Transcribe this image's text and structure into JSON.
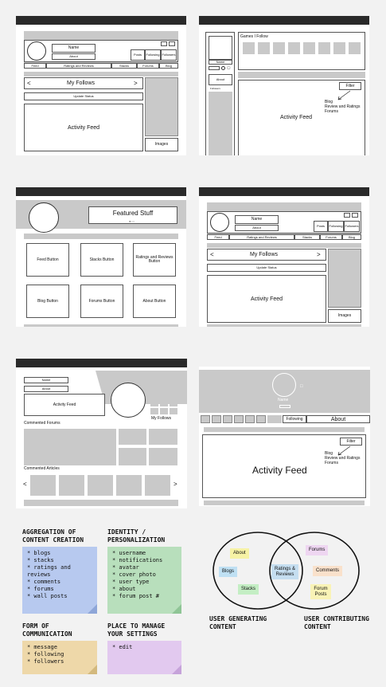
{
  "wf1": {
    "name": "Name",
    "about": "About",
    "profile_buttons": [
      "Posts",
      "Following",
      "Followers"
    ],
    "tabs": [
      "Feed",
      "Ratings and Reviews",
      "Stacks",
      "Forums",
      "Blog"
    ],
    "follows_title": "My Follows",
    "update_status": "Update Status",
    "activity_feed": "Activity Feed",
    "images": "Images"
  },
  "wf2": {
    "games_title": "Games I Follow",
    "name": "Name",
    "about": "About",
    "small_label": "Followers",
    "filter": "Filter",
    "filter_options": [
      "Blog",
      "Review and Ratings",
      "Forums"
    ],
    "activity_feed": "Activity Feed"
  },
  "wf3": {
    "featured": "Featured Stuff",
    "buttons": [
      "Feed Button",
      "Stacks Button",
      "Ratings and Reviews Button",
      "Blog Button",
      "Forums Button",
      "About Button"
    ]
  },
  "wf4": {
    "name": "Name",
    "about": "About",
    "profile_buttons": [
      "Posts",
      "Following",
      "Followers"
    ],
    "tabs": [
      "Feed",
      "Ratings and Reviews",
      "Stacks",
      "Forums",
      "Blog"
    ],
    "follows_title": "My Follows",
    "update_status": "Update Status",
    "activity_feed": "Activity Feed",
    "images": "Images"
  },
  "wf5": {
    "name": "Name",
    "about": "About",
    "activity_feed": "Activity Feed",
    "my_follows": "My Follows",
    "commented_forums": "Commented Forums",
    "commented_articles": "Commented Articles"
  },
  "wf6": {
    "name": "Name",
    "following": "Following",
    "about": "About",
    "filter": "Filter",
    "filter_options": [
      "Blog",
      "Review and Ratings",
      "Forums"
    ],
    "activity_feed": "Activity Feed"
  },
  "notes": [
    {
      "heading": "AGGREGATION OF\nCONTENT CREATION",
      "items": [
        "blogs",
        "stacks",
        "ratings and reviews",
        "comments",
        "forums",
        "wall posts"
      ],
      "color": "#b7c9ef"
    },
    {
      "heading": "IDENTITY /\nPERSONALIZATION",
      "items": [
        "username",
        "notifications",
        "avatar",
        "cover photo",
        "user type",
        "about",
        "forum post #"
      ],
      "color": "#b8dfbc"
    },
    {
      "heading": "FORM OF\nCOMMUNICATION",
      "items": [
        "message",
        "following",
        "followers"
      ],
      "color": "#eed8a9"
    },
    {
      "heading": "PLACE TO MANAGE\nYOUR SETTINGS",
      "items": [
        "edit"
      ],
      "color": "#e2c9ef"
    }
  ],
  "venn": {
    "left_tags": [
      "About",
      "Blogs",
      "Stacks"
    ],
    "center_tag": "Ratings & Reviews",
    "right_tags": [
      "Forums",
      "Comments",
      "Forum Posts"
    ],
    "left_label": "USER GENERATING\nCONTENT",
    "right_label": "USER CONTRIBUTING\nCONTENT",
    "colors": {
      "about": "#f6f2a5",
      "blogs": "#bfe0f3",
      "stacks": "#c4eec4",
      "center": "#c5def0",
      "forums": "#eed6f1",
      "comments": "#f9e1cb",
      "forum_posts": "#f9f3b6"
    }
  }
}
